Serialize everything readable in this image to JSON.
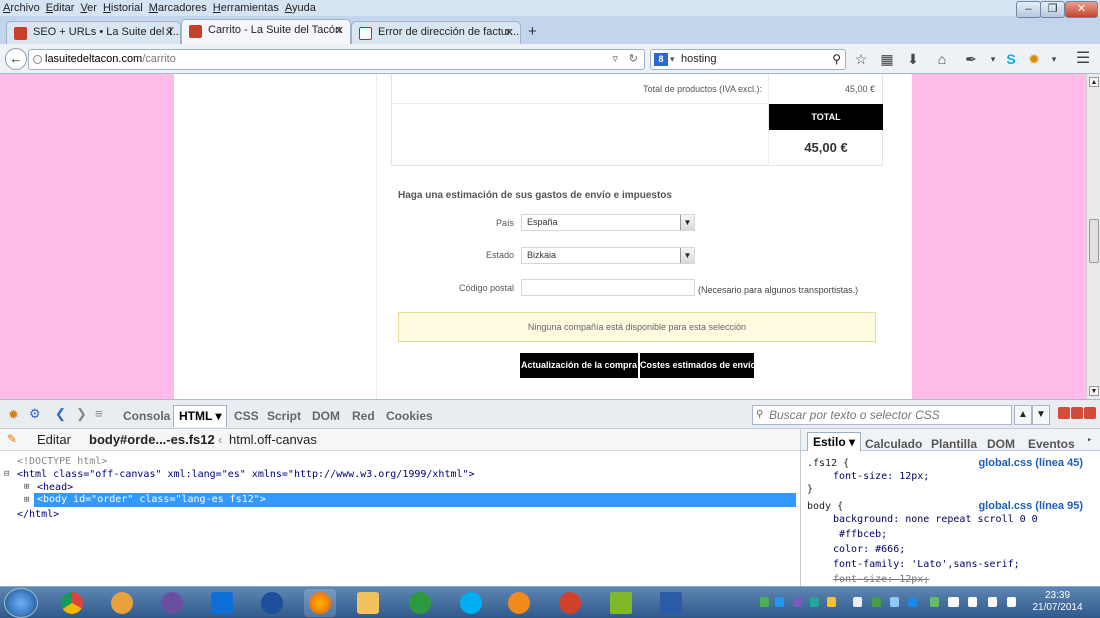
{
  "menubar": {
    "items": [
      "Archivo",
      "Editar",
      "Ver",
      "Historial",
      "Marcadores",
      "Herramientas",
      "Ayuda"
    ]
  },
  "window_controls": {
    "minimize": "–",
    "restore": "❐",
    "close": "✕"
  },
  "tabs": [
    {
      "title": "SEO + URLs • La Suite del T...",
      "close": "✕",
      "favicon_color": "#c8402a"
    },
    {
      "title": "Carrito - La Suite del Tacón",
      "close": "✕",
      "favicon_color": "#c8402a"
    },
    {
      "title": "Error de dirección de factur...",
      "close": "✕",
      "favicon_color": "#c8202a"
    }
  ],
  "new_tab": "+",
  "navbar": {
    "url_host": "lasuitedeltacon.com",
    "url_path": "/carrito",
    "search_value": "hosting",
    "search_engine_label": "8"
  },
  "cart": {
    "total_products_label": "Total de productos (IVA excl.):",
    "total_products_value": "45,00 €",
    "total_label": "TOTAL",
    "total_value": "45,00 €"
  },
  "shipping": {
    "heading": "Haga una estimación de sus gastos de envío e impuestos",
    "country_label": "País",
    "country_value": "España",
    "state_label": "Estado",
    "state_value": "Bizkaia",
    "zip_label": "Código postal",
    "zip_value": "",
    "zip_note": "(Necesario para algunos transportistas.)",
    "notice": "Ninguna compañía está disponible para esta selección",
    "update_button": "Actualización de la compra",
    "estimate_button": "Costes estimados de envío"
  },
  "devtools": {
    "tabs": [
      "Consola",
      "HTML ▾",
      "CSS",
      "Script",
      "DOM",
      "Red",
      "Cookies"
    ],
    "search_placeholder": "Buscar por texto o selector CSS",
    "edit_label": "Editar",
    "crumb_active": "body#orde...-es.fs12",
    "crumb_parent": "html.off-canvas",
    "html_lines": {
      "doctype": "<!DOCTYPE html>",
      "html_open": "<html class=\"off-canvas\" xml:lang=\"es\" xmlns=\"http://www.w3.org/1999/xhtml\">",
      "head": "<head>",
      "body": "<body id=\"order\" class=\"lang-es fs12\">",
      "html_close": "</html>"
    },
    "style_tabs": [
      "Estilo ▾",
      "Calculado",
      "Plantilla",
      "DOM",
      "Eventos"
    ],
    "rules": [
      {
        "selector": ".fs12 {",
        "source": "global.css (línea 45)",
        "decls": [
          "font-size: 12px;"
        ],
        "close": "}"
      },
      {
        "selector": "body {",
        "source": "global.css (línea 95)",
        "decls": [
          "background: none repeat scroll 0 0",
          "#ffbceb;",
          "color: #666;",
          "font-family: 'Lato',sans-serif;",
          "font-size: 12px;"
        ]
      }
    ]
  },
  "clock": {
    "time": "23:39",
    "date": "21/07/2014"
  },
  "colors": {
    "page_bg": "#ffbceb",
    "accent": "#1d5eb6",
    "selection": "#3399ff"
  }
}
